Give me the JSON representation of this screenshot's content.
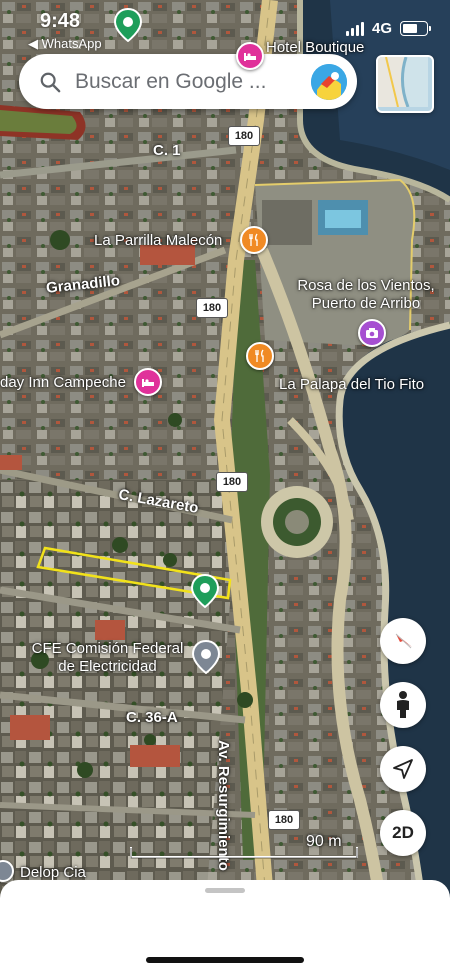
{
  "status_bar": {
    "time": "9:48",
    "back_app": "◀ WhatsApp",
    "network": "4G"
  },
  "search": {
    "placeholder": "Buscar en Google ..."
  },
  "map": {
    "labels": {
      "hotel_boutique": "Hotel Boutique",
      "c1": "C. 1",
      "la_parrilla": "La Parrilla Malecón",
      "granadillo": "Granadillo",
      "rosa_vientos_1": "Rosa de los Vientos,",
      "rosa_vientos_2": "Puerto de Arribo",
      "holiday_inn": "day Inn Campeche",
      "la_palapa": "La Palapa del Tio Fito",
      "c_lazareto": "C. Lazareto",
      "cfe_1": "CFE Comisión Federal",
      "cfe_2": "de Electricidad",
      "c36a": "C. 36-A",
      "av_resurgimiento": "Av. Resurgimiento",
      "delop": "Delop Cia"
    },
    "shields": [
      "180",
      "180",
      "180",
      "180"
    ],
    "scale_label": "90 m"
  },
  "controls": {
    "compass": "compass-icon",
    "street_view": "pegman-icon",
    "my_location": "navigation-arrow-icon",
    "view_mode": "2D"
  },
  "colors": {
    "water": "#1f3447",
    "road": "#d8c489",
    "selection_outline": "#f2e21a",
    "pin_green": "#1e9e5a",
    "poi_orange": "#f08a24",
    "poi_pink": "#e0319a",
    "poi_purple": "#a64fd1"
  }
}
